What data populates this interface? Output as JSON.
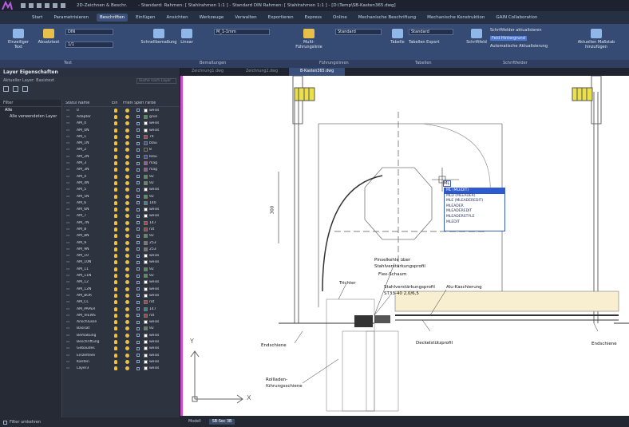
{
  "titlebar": {
    "doc_tab1": "2D-Zeichnen & Beschr.",
    "title": "- Standard: Rahmen: [ Stahlrahmen 1:1 ] - Standard DIN Rahmen: [ Stahlrahmen 1:1 ] - [D:\\Temp\\SB-Kasten365.dwg]"
  },
  "ribbon_tabs": [
    "Start",
    "Parametrisieren",
    "Beschriften",
    "Einfügen",
    "Ansichten",
    "Werkzeuge",
    "Verwalten",
    "Exportieren",
    "Express",
    "Online",
    "Mechanische Beschriftung",
    "Mechanische Konstruktion",
    "GAIN Collaboration"
  ],
  "ribbon": {
    "einfach_text": "Einzeiliger Text",
    "mtext": "Absatztext",
    "text_style": "DIN",
    "text_height": "1/1",
    "schnell_bemassung": "Schnellbemaßung",
    "linear": "Linear",
    "dim_style": "M_1-1mm",
    "multi_fuehrung": "Multi-Führungslinie",
    "fuehr_style": "Standard",
    "tabelle": "Tabelle",
    "tab_style": "Standard",
    "tabellen_export": "Tabellen Export",
    "schriftfeld": "Schriftfeld",
    "sf1": "Schriftfelder aktualisieren",
    "sf2": "Feld Hintergrund",
    "sf3": "Automatische Aktualisierung",
    "massstab": "Aktuellen Maßstab hinzufügen",
    "groups": [
      "Text",
      "Bemaßungen",
      "Führungslinien",
      "Tabellen",
      "Schriftfelder"
    ]
  },
  "panel": {
    "title": "Layer Eigenschaften",
    "current_layer": "Aktueller Layer: Basistext",
    "search_placeholder": "Suche nach Layer",
    "filter_head": "Filter",
    "tree": [
      "Alle",
      "Alle verwendeten Layer"
    ],
    "col_status": "Status",
    "col_name": "Name",
    "col_ein": "Ein",
    "col_frz": "Frieren",
    "col_lock": "Sperren",
    "col_color": "Farbe",
    "footer": "Filter umkehren",
    "layers": [
      {
        "name": "0",
        "color": "#ffffff",
        "cname": "weiss"
      },
      {
        "name": "Adapter",
        "color": "#22aa44",
        "cname": "grün"
      },
      {
        "name": "AM_0",
        "color": "#ffffff",
        "cname": "weiss"
      },
      {
        "name": "AM_0N",
        "color": "#ffffff",
        "cname": "weiss"
      },
      {
        "name": "AM_1",
        "color": "#d03030",
        "cname": "74"
      },
      {
        "name": "AM_1N",
        "color": "#2b4dd6",
        "cname": "blau"
      },
      {
        "name": "AM_2",
        "color": "#333333",
        "cname": "8"
      },
      {
        "name": "AM_2N",
        "color": "#2b4dd6",
        "cname": "blau"
      },
      {
        "name": "AM_3",
        "color": "#c23ac2",
        "cname": "mag"
      },
      {
        "name": "AM_3N",
        "color": "#c23ac2",
        "cname": "mag"
      },
      {
        "name": "AM_4",
        "color": "#3fa14a",
        "cname": "92"
      },
      {
        "name": "AM_4N",
        "color": "#3fa14a",
        "cname": "92"
      },
      {
        "name": "AM_5",
        "color": "#ffffff",
        "cname": "weiss"
      },
      {
        "name": "AM_5N",
        "color": "#3fa14a",
        "cname": "92"
      },
      {
        "name": "AM_6",
        "color": "#1e8fa8",
        "cname": "140"
      },
      {
        "name": "AM_6N",
        "color": "#ffffff",
        "cname": "weiss"
      },
      {
        "name": "AM_7",
        "color": "#ffffff",
        "cname": "weiss"
      },
      {
        "name": "AM_7N",
        "color": "#d03030",
        "cname": "147"
      },
      {
        "name": "AM_8",
        "color": "#d03030",
        "cname": "rot"
      },
      {
        "name": "AM_8N",
        "color": "#3fa14a",
        "cname": "92"
      },
      {
        "name": "AM_9",
        "color": "#777777",
        "cname": "253"
      },
      {
        "name": "AM_9N",
        "color": "#777777",
        "cname": "253"
      },
      {
        "name": "AM_10",
        "color": "#ffffff",
        "cname": "weiss"
      },
      {
        "name": "AM_10N",
        "color": "#ffffff",
        "cname": "weiss"
      },
      {
        "name": "AM_11",
        "color": "#3fa14a",
        "cname": "92"
      },
      {
        "name": "AM_11N",
        "color": "#3fa14a",
        "cname": "92"
      },
      {
        "name": "AM_12",
        "color": "#ffffff",
        "cname": "weiss"
      },
      {
        "name": "AM_12N",
        "color": "#ffffff",
        "cname": "weiss"
      },
      {
        "name": "AM_BOR",
        "color": "#ffffff",
        "cname": "weiss"
      },
      {
        "name": "AM_CL",
        "color": "#d03030",
        "cname": "rot"
      },
      {
        "name": "AM_PAPER",
        "color": "#1e8fa8",
        "cname": "147"
      },
      {
        "name": "AM_VIEWS",
        "color": "#d03030",
        "cname": "rot"
      },
      {
        "name": "Anschlüsse",
        "color": "#ffffff",
        "cname": "weiss"
      },
      {
        "name": "Basisat",
        "color": "#3fa14a",
        "cname": "92"
      },
      {
        "name": "Bemaßung",
        "color": "#ffffff",
        "cname": "weiss"
      },
      {
        "name": "Beschriftung",
        "color": "#ffffff",
        "cname": "weiss"
      },
      {
        "name": "Gebäudes",
        "color": "#ffffff",
        "cname": "weiss"
      },
      {
        "name": "Einzelteile",
        "color": "#ffffff",
        "cname": "weiss"
      },
      {
        "name": "Kanten",
        "color": "#ffffff",
        "cname": "weiss"
      },
      {
        "name": "Layer3",
        "color": "#ffffff",
        "cname": "weiss"
      }
    ]
  },
  "doc_tabs": [
    "Zeichnung1.dwg",
    "Zeichnung2.dwg",
    "B-Kasten365.dwg"
  ],
  "autocomplete": {
    "input": "ML",
    "items": [
      "ML (MLEDIT)",
      "MLD (MLEADER)",
      "MLE (MLEADEREDIT)",
      "MLEADER",
      "MLEADEREDIT",
      "MLEADERSTYLE",
      "MLEDIT"
    ]
  },
  "cad_labels": {
    "dim": "300",
    "l1": "Pinselkehle über",
    "l1b": "Stahlverstärkungsprofil",
    "l2": "Flex-Schaum",
    "l3": "Trichter",
    "l4": "Stahlverstärkungsprofil",
    "l4b": "ST33-40 2,0/6,5",
    "l5": "Alu-Kaschierung",
    "l6": "Endschiene",
    "l7": "Deckelstützprofil",
    "l8": "Endschiene",
    "l9": "Rollladen-",
    "l9b": "führungsschiene",
    "axis_y": "Y",
    "axis_x": "X"
  },
  "statusbar": [
    "Modell",
    "SB-Sec 3B"
  ]
}
